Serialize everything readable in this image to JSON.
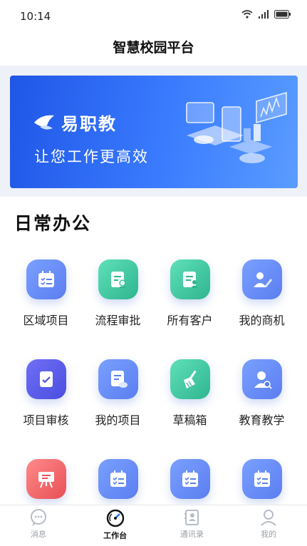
{
  "status_bar": {
    "time": "10:14"
  },
  "header": {
    "title": "智慧校园平台"
  },
  "banner": {
    "brand": "易职教",
    "slogan": "让您工作更高效"
  },
  "section": {
    "title": "日常办公"
  },
  "apps": [
    {
      "label": "区域项目",
      "icon": "calendar-list-icon",
      "color": "#6a8ff2"
    },
    {
      "label": "流程审批",
      "icon": "approval-doc-icon",
      "color": "#45c7a3"
    },
    {
      "label": "所有客户",
      "icon": "customer-doc-icon",
      "color": "#45c7a3"
    },
    {
      "label": "我的商机",
      "icon": "person-pen-icon",
      "color": "#6a8ff2"
    },
    {
      "label": "项目审核",
      "icon": "review-check-icon",
      "color": "#5c63e6"
    },
    {
      "label": "我的项目",
      "icon": "doc-cloud-icon",
      "color": "#6a8ff2"
    },
    {
      "label": "草稿箱",
      "icon": "broom-icon",
      "color": "#45c7a3"
    },
    {
      "label": "教育教学",
      "icon": "teacher-search-icon",
      "color": "#6a8ff2"
    },
    {
      "label": "",
      "icon": "presentation-board-icon",
      "color": "#f0696b"
    },
    {
      "label": "",
      "icon": "calendar-list-icon",
      "color": "#6a8ff2"
    },
    {
      "label": "",
      "icon": "calendar-list-icon",
      "color": "#6a8ff2"
    },
    {
      "label": "",
      "icon": "calendar-list-icon",
      "color": "#6a8ff2"
    }
  ],
  "tabs": [
    {
      "label": "消息",
      "icon": "chat-icon",
      "active": false
    },
    {
      "label": "工作台",
      "icon": "dashboard-gauge-icon",
      "active": true
    },
    {
      "label": "通讯录",
      "icon": "contacts-book-icon",
      "active": false
    },
    {
      "label": "我的",
      "icon": "profile-icon",
      "active": false
    }
  ]
}
